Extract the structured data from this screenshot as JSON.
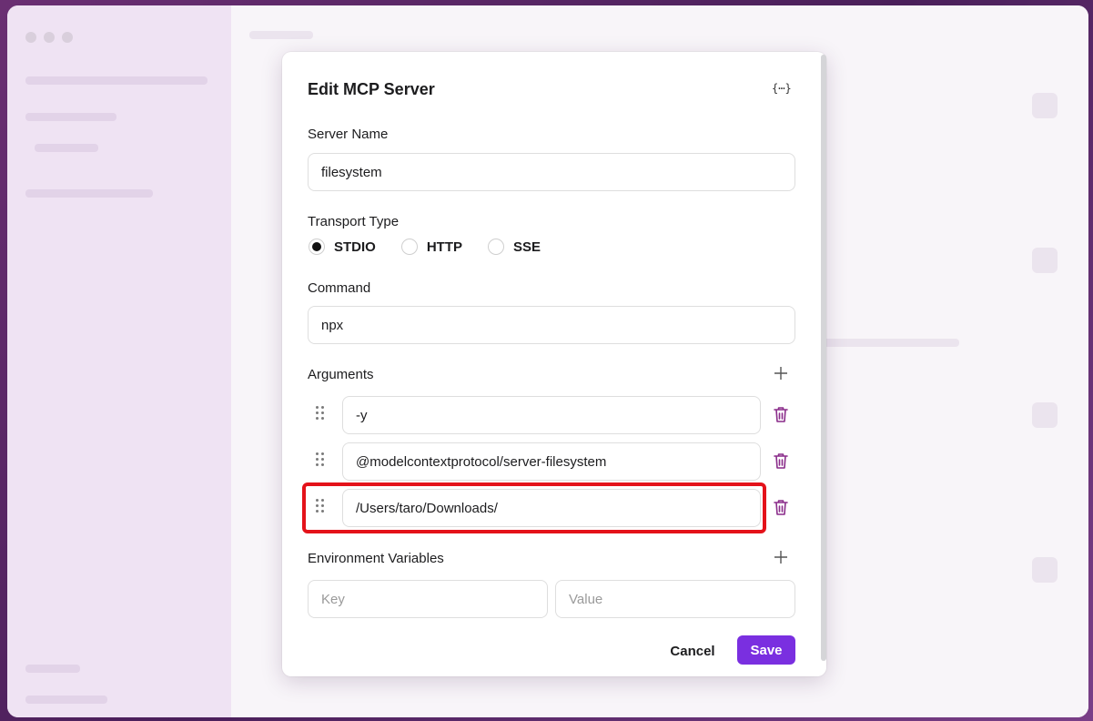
{
  "dialog": {
    "title": "Edit MCP Server",
    "json_toggle_label": "{⋯}",
    "server_name": {
      "label": "Server Name",
      "value": "filesystem"
    },
    "transport": {
      "label": "Transport Type",
      "options": [
        "STDIO",
        "HTTP",
        "SSE"
      ],
      "selected": "STDIO"
    },
    "command": {
      "label": "Command",
      "value": "npx"
    },
    "arguments": {
      "label": "Arguments",
      "items": [
        "-y",
        "@modelcontextprotocol/server-filesystem",
        "/Users/taro/Downloads/"
      ]
    },
    "env": {
      "label": "Environment Variables",
      "key_placeholder": "Key",
      "value_placeholder": "Value"
    },
    "cancel_label": "Cancel",
    "save_label": "Save"
  },
  "colors": {
    "accent": "#7a2fe0",
    "trash": "#8a2c8a",
    "highlight": "#e4121a"
  },
  "icons": {
    "json": "code-braces-icon",
    "add": "plus-icon",
    "drag": "drag-handle-icon",
    "delete": "trash-icon"
  }
}
